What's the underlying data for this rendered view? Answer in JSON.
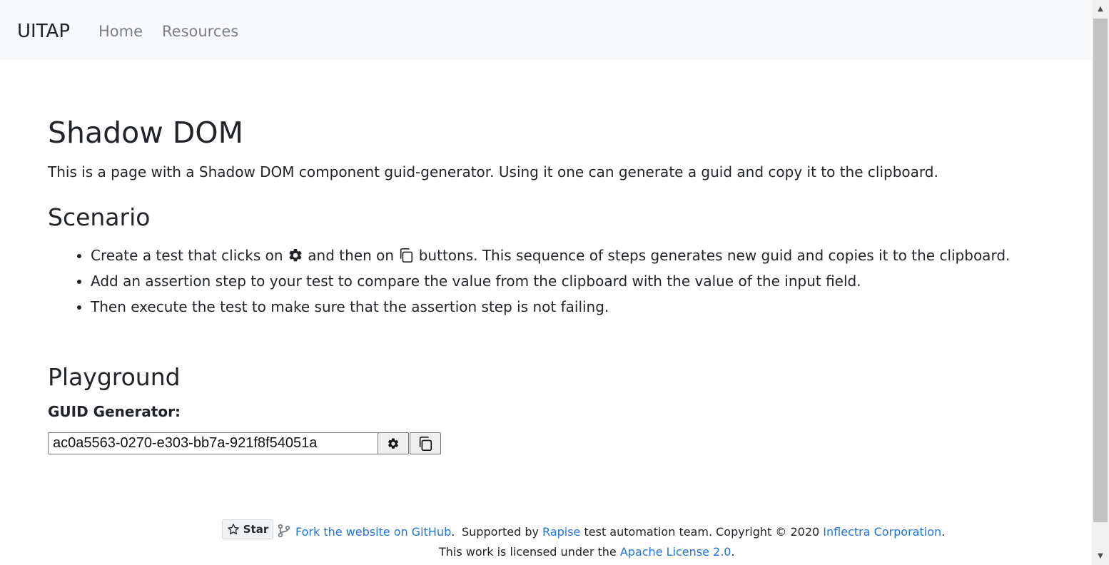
{
  "navbar": {
    "brand": "UITAP",
    "links": [
      "Home",
      "Resources"
    ]
  },
  "page": {
    "title": "Shadow DOM",
    "intro": "This is a page with a Shadow DOM component guid-generator. Using it one can generate a guid and copy it to the clipboard."
  },
  "scenario": {
    "heading": "Scenario",
    "step1_part1": "Create a test that clicks on ",
    "step1_part2": " and then on ",
    "step1_part3": " buttons. This sequence of steps generates new guid and copies it to the clipboard.",
    "step2": "Add an assertion step to your test to compare the value from the clipboard with the value of the input field.",
    "step3": "Then execute the test to make sure that the assertion step is not failing."
  },
  "playground": {
    "heading": "Playground",
    "label": "GUID Generator:",
    "guid_value": "ac0a5563-0270-e303-bb7a-921f8f54051a",
    "generate_icon": "gear-icon",
    "copy_icon": "copy-icon"
  },
  "footer": {
    "star_label": "Star",
    "fork_link": "Fork the website on GitHub",
    "fork_period": ".",
    "supported_prefix": "Supported by ",
    "rapise": "Rapise",
    "supported_mid": " test automation team. Copyright © 2020 ",
    "inflectra": "Inflectra Corporation",
    "supported_suffix": ".",
    "license_prefix": "This work is licensed under the ",
    "license_link": "Apache License 2.0",
    "license_suffix": "."
  },
  "colors": {
    "navbar_bg": "#f8f9fa",
    "link": "#1f75e0",
    "text": "#212529",
    "nav_link": "#7d7f82"
  }
}
